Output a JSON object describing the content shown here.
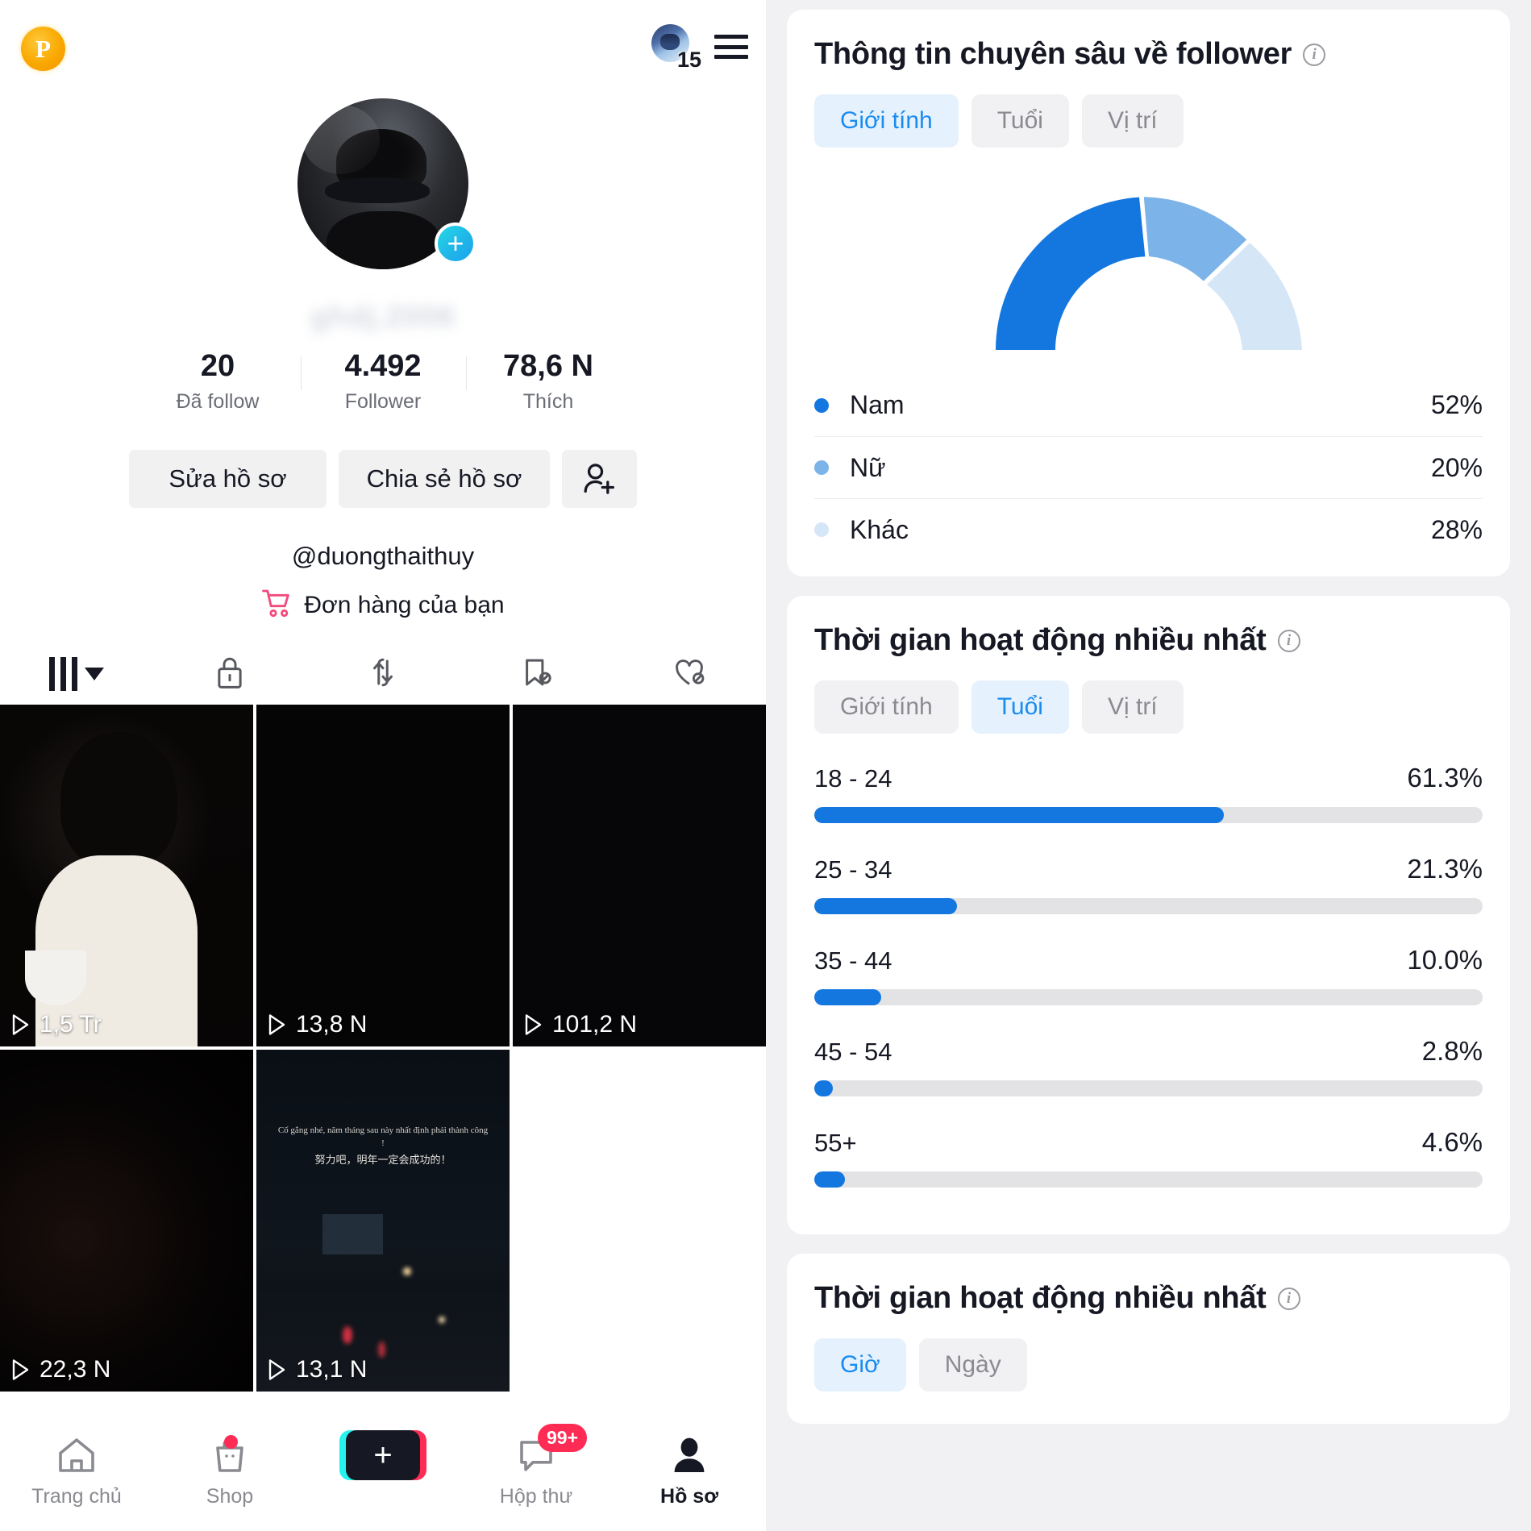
{
  "theme": {
    "accent_blue": "#1477e0",
    "accent_blue_mid": "#7cb3e8",
    "accent_blue_light": "#d5e6f7",
    "tiktok_red": "#fe2c55",
    "tiktok_cyan": "#25f4ee",
    "track_gray": "#e3e3e5",
    "chip_active_bg": "#e5f1fd",
    "chip_active_text": "#1a8cf0"
  },
  "profile": {
    "points_badge": "P",
    "notification_count": "15",
    "blurred_display_name": "ghdj.2006",
    "avatar_add_label": "+",
    "stats": [
      {
        "value": "20",
        "label": "Đã follow"
      },
      {
        "value": "4.492",
        "label": "Follower"
      },
      {
        "value": "78,6 N",
        "label": "Thích"
      }
    ],
    "buttons": {
      "edit_profile": "Sửa hồ sơ",
      "share_profile": "Chia sẻ hồ sơ",
      "add_friend_icon": "person-add-icon"
    },
    "handle": "@duongthaithuy",
    "orders_link": "Đơn hàng của bạn",
    "tabs": [
      {
        "name": "grid",
        "icon": "grid-bars-icon",
        "active": true
      },
      {
        "name": "private",
        "icon": "lock-icon",
        "active": false
      },
      {
        "name": "reposts",
        "icon": "repost-arrows-icon",
        "active": false
      },
      {
        "name": "saved",
        "icon": "bookmark-hidden-icon",
        "active": false
      },
      {
        "name": "liked",
        "icon": "heart-hidden-icon",
        "active": false
      }
    ],
    "videos": [
      {
        "views": "1,5 Tr"
      },
      {
        "views": "13,8 N"
      },
      {
        "views": "101,2 N"
      },
      {
        "views": "22,3 N"
      },
      {
        "views": "13,1 N"
      }
    ],
    "video5_overlay_text": "Cố gắng nhé, năm tháng sau này nhất định phải thành công !",
    "video5_overlay_text_cn": "努力吧，明年一定会成功的！"
  },
  "bottom_nav": {
    "items": [
      {
        "label": "Trang chủ",
        "icon": "home-icon",
        "active": false,
        "badge": ""
      },
      {
        "label": "Shop",
        "icon": "shop-bag-icon",
        "active": false,
        "badge": "dot"
      },
      {
        "label": "",
        "icon": "create-plus-icon",
        "active": false,
        "badge": ""
      },
      {
        "label": "Hộp thư",
        "icon": "inbox-message-icon",
        "active": false,
        "badge": "99+"
      },
      {
        "label": "Hồ sơ",
        "icon": "person-icon",
        "active": true,
        "badge": ""
      }
    ]
  },
  "analytics": {
    "follower_insights": {
      "title": "Thông tin chuyên sâu về follower",
      "info_icon": "info-circle-icon",
      "tabs": [
        {
          "label": "Giới tính",
          "active": true
        },
        {
          "label": "Tuổi",
          "active": false
        },
        {
          "label": "Vị trí",
          "active": false
        }
      ],
      "legend": [
        {
          "name": "Nam",
          "value": "52%",
          "color": "#1477e0"
        },
        {
          "name": "Nữ",
          "value": "20%",
          "color": "#7cb3e8"
        },
        {
          "name": "Khác",
          "value": "28%",
          "color": "#d5e6f7"
        }
      ]
    },
    "most_active_age": {
      "title": "Thời gian hoạt động nhiều nhất",
      "info_icon": "info-circle-icon",
      "tabs": [
        {
          "label": "Giới tính",
          "active": false
        },
        {
          "label": "Tuổi",
          "active": true
        },
        {
          "label": "Vị trí",
          "active": false
        }
      ],
      "bars": [
        {
          "label": "18 - 24",
          "value": "61.3%",
          "pct": 61.3
        },
        {
          "label": "25 - 34",
          "value": "21.3%",
          "pct": 21.3
        },
        {
          "label": "35 - 44",
          "value": "10.0%",
          "pct": 10.0
        },
        {
          "label": "45 - 54",
          "value": "2.8%",
          "pct": 2.8
        },
        {
          "label": "55+",
          "value": "4.6%",
          "pct": 4.6
        }
      ]
    },
    "most_active_time": {
      "title": "Thời gian hoạt động nhiều nhất",
      "info_icon": "info-circle-icon",
      "tabs": [
        {
          "label": "Giờ",
          "active": true
        },
        {
          "label": "Ngày",
          "active": false
        }
      ]
    }
  },
  "chart_data": [
    {
      "type": "pie",
      "title": "Thông tin chuyên sâu về follower — Giới tính",
      "subtitle": "Semicircular donut gauge",
      "labels": [
        "Nam",
        "Nữ",
        "Khác"
      ],
      "values": [
        52,
        20,
        28
      ],
      "colors": [
        "#1477e0",
        "#7cb3e8",
        "#d5e6f7"
      ],
      "unit": "%",
      "legend_position": "below",
      "grid": false
    },
    {
      "type": "bar",
      "title": "Thời gian hoạt động nhiều nhất — Tuổi",
      "orientation": "horizontal",
      "categories": [
        "18 - 24",
        "25 - 34",
        "35 - 44",
        "45 - 54",
        "55+"
      ],
      "values": [
        61.3,
        21.3,
        10.0,
        2.8,
        4.6
      ],
      "xlabel": "",
      "ylabel": "",
      "xlim": [
        0,
        100
      ],
      "unit": "%",
      "bar_color": "#1477e0",
      "track_color": "#e3e3e5",
      "grid": false,
      "legend_position": "none"
    }
  ]
}
